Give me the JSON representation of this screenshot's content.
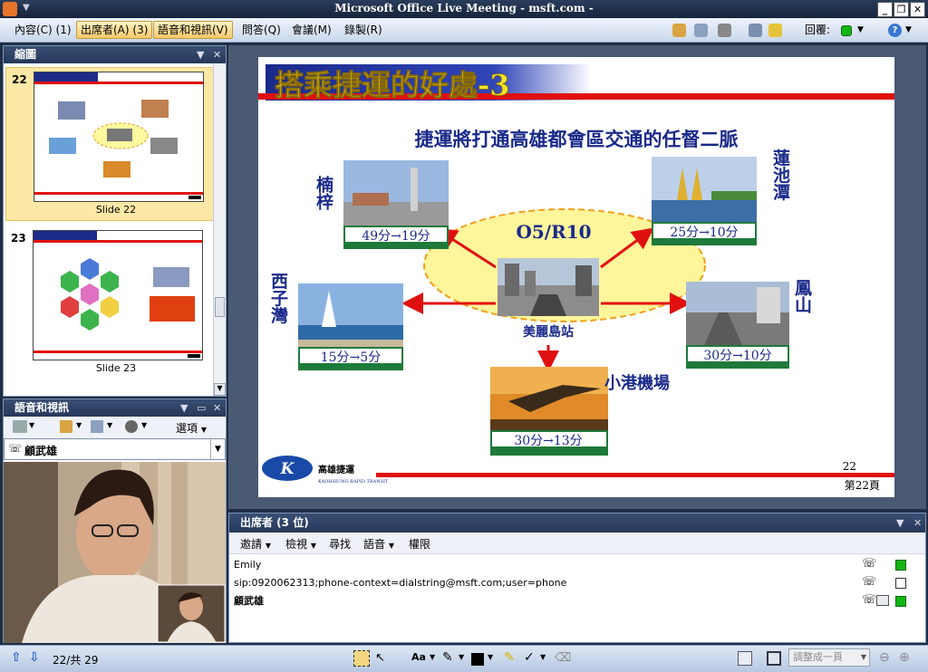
{
  "window": {
    "title": "Microsoft Office Live Meeting - msft.com -"
  },
  "menu": {
    "items": [
      "內容(C) (1)",
      "出席者(A) (3)",
      "語音和視訊(V)",
      "問答(Q)",
      "會議(M)",
      "錄製(R)"
    ],
    "feedback_label": "回覆:",
    "colors": {
      "accent_highlight": "#f7c96a",
      "status_green": "#13b513"
    }
  },
  "thumbnails": {
    "title": "縮圖",
    "slides": [
      {
        "number": "22",
        "caption": "Slide 22"
      },
      {
        "number": "23",
        "caption": "Slide 23"
      }
    ]
  },
  "audio_video": {
    "title": "語音和視訊",
    "options_label": "選項",
    "active_speaker": "顧武雄"
  },
  "slide": {
    "title": "搭乘捷運的好處-3",
    "subtitle": "捷運將打通高雄都會區交通的任督二脈",
    "center_code": "O5/R10",
    "center_station": "美麗島站",
    "destinations": [
      {
        "name": "楠梓",
        "time": "49分→19分"
      },
      {
        "name": "蓮池潭",
        "time": "25分→10分"
      },
      {
        "name": "西子灣",
        "time": "15分→5分"
      },
      {
        "name": "鳳山",
        "time": "30分→10分"
      },
      {
        "name": "小港機場",
        "time": "30分→13分"
      }
    ],
    "logo_text": "高雄捷運",
    "logo_subtext": "KAOHSIUNG RAPID TRANSIT",
    "page_number": "22",
    "page_label": "第22頁"
  },
  "attendees": {
    "title": "出席者 (3 位)",
    "toolbar": [
      "邀請",
      "檢視",
      "尋找",
      "語音",
      "權限"
    ],
    "list": [
      {
        "name": "Emily",
        "status": "green",
        "bold": false
      },
      {
        "name": "sip:0920062313;phone-context=dialstring@msft.com;user=phone",
        "status": "empty",
        "bold": false
      },
      {
        "name": "顧武雄",
        "status": "green",
        "bold": true
      }
    ]
  },
  "footer": {
    "page_position": "22/共 29",
    "zoom_placeholder": "調整成一頁"
  }
}
